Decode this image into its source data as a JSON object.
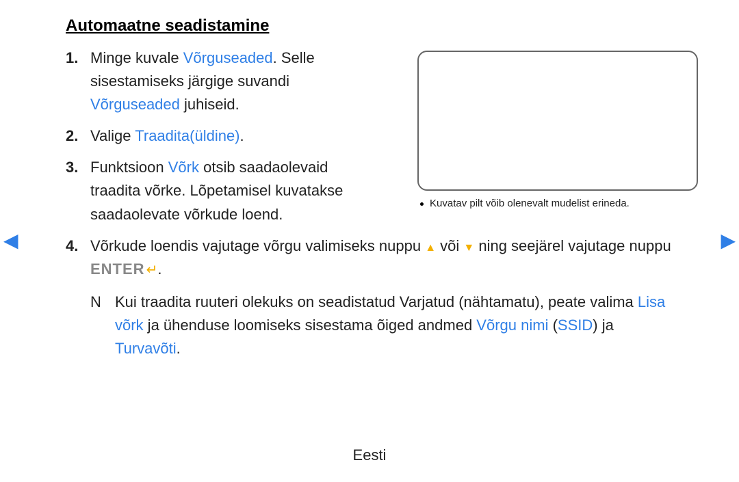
{
  "title": "Automaatne seadistamine",
  "steps": {
    "1": {
      "num": "1.",
      "t1": "Minge kuvale ",
      "t2": "Võrguseaded",
      "t3": ". Selle sisestamiseks järgige suvandi ",
      "t4": "Võrguseaded",
      "t5": " juhiseid."
    },
    "2": {
      "num": "2.",
      "t1": "Valige ",
      "t2": "Traadita(üldine)",
      "t3": "."
    },
    "3": {
      "num": "3.",
      "t1": "Funktsioon ",
      "t2": "Võrk",
      "t3": " otsib saadaolevaid traadita võrke. Lõpetamisel kuvatakse saadaolevate võrkude loend."
    },
    "4": {
      "num": "4.",
      "t1": "Võrkude loendis vajutage võrgu valimiseks nuppu ",
      "t2": " või ",
      "t3": " ning seejärel vajutage nuppu ",
      "enter": "ENTER",
      "t4": "."
    }
  },
  "note": {
    "mark": "N",
    "t1": "Kui traadita ruuteri olekuks on seadistatud Varjatud (nähtamatu), peate valima ",
    "t2": "Lisa võrk",
    "t3": " ja ühenduse loomiseks sisestama õiged andmed ",
    "t4": "Võrgu nimi",
    "t5": " (",
    "t6": "SSID",
    "t7": ") ja ",
    "t8": "Turvavõti",
    "t9": "."
  },
  "aside_note": "Kuvatav pilt võib olenevalt mudelist erineda.",
  "footer": "Eesti"
}
